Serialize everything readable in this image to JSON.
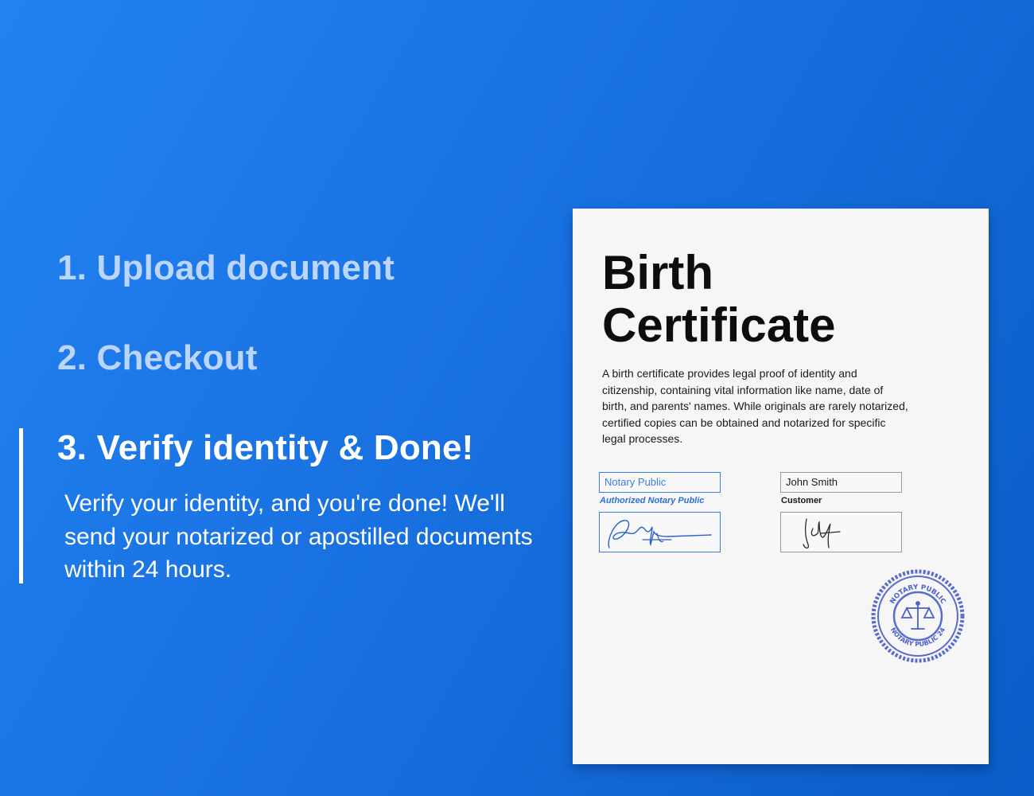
{
  "steps": [
    {
      "label": "1. Upload document",
      "active": false
    },
    {
      "label": "2. Checkout",
      "active": false
    },
    {
      "label": "3. Verify identity & Done!",
      "active": true
    }
  ],
  "active_description": "Verify your identity, and you're done! We'll send your notarized or apostilled documents within 24 hours.",
  "document": {
    "title_line1": "Birth",
    "title_line2": "Certificate",
    "description": "A birth certificate provides legal proof of identity and citizenship, containing vital information like name, date of birth, and parents' names. While originals are rarely notarized, certified copies can be obtained and notarized for specific legal processes.",
    "notary_field_value": "Notary Public",
    "notary_field_label": "Authorized Notary Public",
    "customer_field_value": "John Smith",
    "customer_field_label": "Customer",
    "seal_text_top": "NOTARY PUBLIC",
    "seal_text_bottom": "NOTARY PUBLIC 24"
  },
  "colors": {
    "background_start": "#2382f0",
    "background_end": "#0a5cc7",
    "inactive_step": "#bcd6fb",
    "active_step": "#ffffff",
    "notary_blue": "#3a7fe0",
    "seal_blue": "#4c5fc8"
  },
  "icons": {
    "seal": "notary-seal-icon",
    "scales": "scales-of-justice-icon"
  }
}
